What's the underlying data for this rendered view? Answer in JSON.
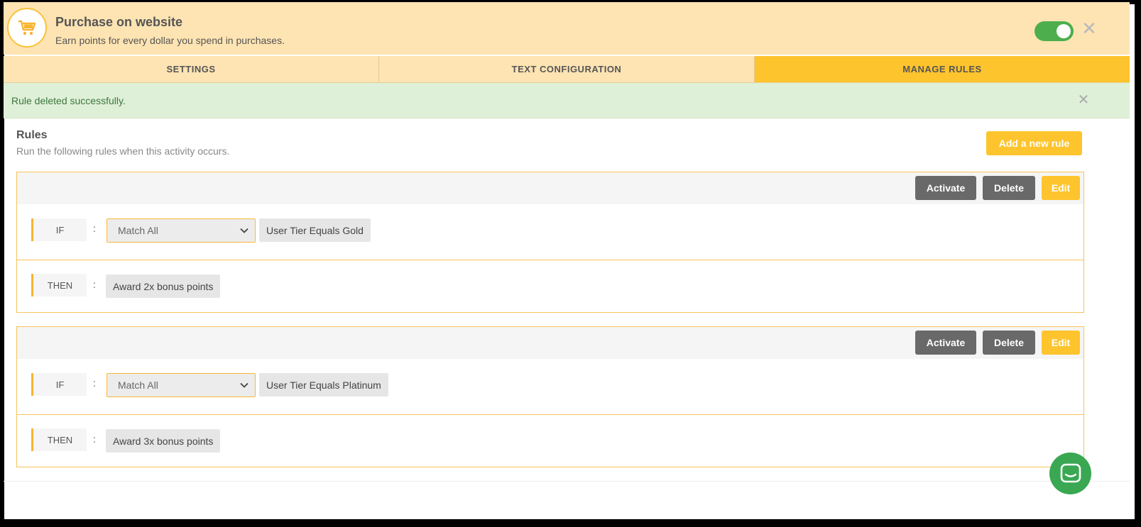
{
  "header": {
    "title": "Purchase on website",
    "subtitle": "Earn points for every dollar you spend in purchases.",
    "toggle_on": true,
    "icon": "shopping-cart-icon",
    "close_icon": "close-icon"
  },
  "tabs": [
    {
      "label": "SETTINGS",
      "active": false
    },
    {
      "label": "TEXT CONFIGURATION",
      "active": false
    },
    {
      "label": "MANAGE RULES",
      "active": true
    }
  ],
  "alert": {
    "message": "Rule deleted successfully.",
    "close_icon": "close-icon"
  },
  "rules": {
    "title": "Rules",
    "subtitle": "Run the following rules when this activity occurs.",
    "add_button": "Add a new rule",
    "items": [
      {
        "activate_label": "Activate",
        "delete_label": "Delete",
        "edit_label": "Edit",
        "if_label": "IF",
        "colon": ":",
        "match": "Match All",
        "condition": "User Tier Equals Gold",
        "then_label": "THEN",
        "action": "Award 2x bonus points"
      },
      {
        "activate_label": "Activate",
        "delete_label": "Delete",
        "edit_label": "Edit",
        "if_label": "IF",
        "colon": ":",
        "match": "Match All",
        "condition": "User Tier Equals Platinum",
        "then_label": "THEN",
        "action": "Award 3x bonus points"
      }
    ]
  },
  "chat": {
    "icon": "chat-icon"
  },
  "colors": {
    "header_bg": "#fee4b3",
    "accent": "#fec42d",
    "success_bg": "#dff0d8",
    "success_text": "#3c763d",
    "toggle_on": "#4cae4c",
    "dark_button": "#696969",
    "chat": "#3aa752"
  }
}
